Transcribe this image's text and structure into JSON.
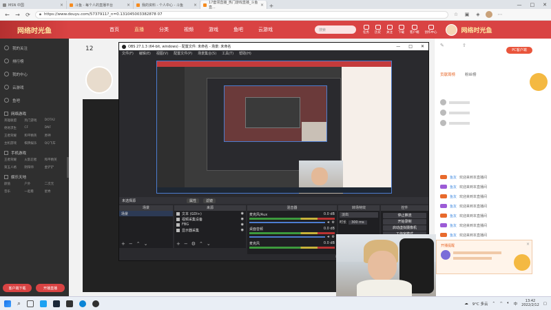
{
  "browser": {
    "tabs": [
      {
        "label": "MSN 中国",
        "active": false
      },
      {
        "label": "斗鱼 - 每个人的直播平台",
        "active": false
      },
      {
        "label": "我的资料 - 个人中心 - 斗鱼",
        "active": false
      },
      {
        "label": "17套领直播_热门游戏直播_斗鱼直...",
        "active": true
      }
    ],
    "url": "https://www.douyu.com/5737911?_n=0.131045003382878 07"
  },
  "site": {
    "logo": "网络时光鱼",
    "nav": [
      "首页",
      "直播",
      "分类",
      "视频",
      "游戏",
      "鱼吧",
      "云游戏"
    ],
    "active_nav": "直播",
    "search_placeholder": "搜索",
    "header_icons": [
      "任务",
      "历史",
      "关注",
      "下载",
      "客户端",
      "创作中心"
    ]
  },
  "sidebar": {
    "items": [
      "我的关注",
      "排行榜",
      "我的中心",
      "云游戏",
      "鱼吧"
    ],
    "sections": [
      {
        "title": "网络游戏",
        "items": [
          "英雄联盟",
          "热门游戏",
          "DOTA2",
          "绝地求生",
          "CF",
          "DNF",
          "王者荣耀",
          "和平精英",
          "原神",
          "主机游戏",
          "棋牌娱乐",
          "QQ飞车"
        ]
      },
      {
        "title": "手机游戏",
        "items": [
          "王者荣耀",
          "火影忍者",
          "和平精英",
          "第五人格",
          "阴阳师",
          "金铲铲"
        ]
      },
      {
        "title": "娱乐天地",
        "items": [
          "颜值",
          "户外",
          "二次元",
          "音乐",
          "一起看",
          "星秀"
        ]
      }
    ],
    "buttons": [
      "客户端下载",
      "开播直播"
    ]
  },
  "obs": {
    "title": "OBS 27.1.3 (64-bit, windows) - 配置文件: 未命名 - 场景: 未命名",
    "menu": [
      "文件(F)",
      "编辑(E)",
      "视图(V)",
      "配置文件(P)",
      "场景集合(S)",
      "工具(T)",
      "帮助(H)"
    ],
    "toolbar_label": "未选择源",
    "toolbar_buttons": [
      "属性",
      "滤镜"
    ],
    "docks": [
      "场景",
      "来源",
      "混音器",
      "转场特效",
      "控件"
    ],
    "scenes": [
      "场景"
    ],
    "sources": [
      "文本 (GDI+)",
      "视频采集设备",
      "FBG",
      "显示器采集"
    ],
    "mixer": [
      {
        "name": "麦克风/Aux",
        "db": "0.0 dB"
      },
      {
        "name": "桌面音频",
        "db": "0.0 dB"
      },
      {
        "name": "麦克风",
        "db": "0.0 dB"
      }
    ],
    "transition": {
      "type": "淡出",
      "duration_label": "时长",
      "duration": "300 ms"
    },
    "controls": [
      "停止推流",
      "开始录制",
      "启动虚拟摄像机",
      "工作室模式",
      "设置",
      "退出"
    ],
    "status": [
      "LIVE: 00:03:25",
      "REC: 00:00:00",
      "CPU: 4.3%, 30.00 fps"
    ]
  },
  "room": {
    "level": "12",
    "follow_count": "2"
  },
  "chat": {
    "tabs": [
      "贡献周榜",
      "粉丝榜"
    ],
    "messages": [
      {
        "user": "鱼友",
        "text": "欢迎来到本直播间"
      },
      {
        "user": "鱼友",
        "text": "欢迎来到本直播间"
      },
      {
        "user": "鱼友",
        "text": "欢迎来到本直播间"
      },
      {
        "user": "鱼友",
        "text": "欢迎来到本直播间"
      },
      {
        "user": "鱼友",
        "text": "欢迎来到本直播间"
      },
      {
        "user": "鱼友",
        "text": "欢迎来到本直播间"
      },
      {
        "user": "鱼友",
        "text": "欢迎来到本直播间"
      }
    ],
    "popup_text": "开播提醒",
    "pc_badge": "PC客户端"
  },
  "taskbar": {
    "weather": "9°C 多云",
    "lang": "中",
    "time": "13:42",
    "date": "2022/2/12"
  },
  "colors": {
    "brand": "#d94343",
    "obs_bg": "#2a2a2e",
    "sidebar": "#2f2f2f"
  }
}
